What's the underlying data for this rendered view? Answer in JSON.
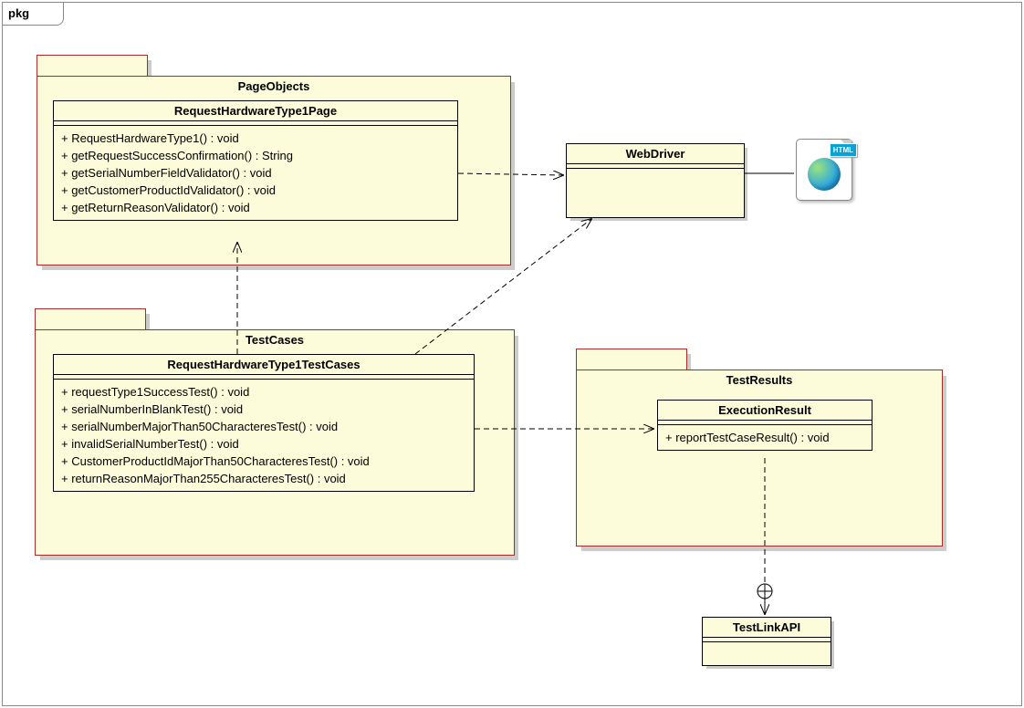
{
  "frame": {
    "label": "pkg"
  },
  "packages": {
    "pageObjects": {
      "title": "PageObjects"
    },
    "testCases": {
      "title": "TestCases"
    },
    "testResults": {
      "title": "TestResults"
    }
  },
  "classes": {
    "requestPage": {
      "name": "RequestHardwareType1Page",
      "ops": [
        "+ RequestHardwareType1() : void",
        "+ getRequestSuccessConfirmation() : String",
        "+ getSerialNumberFieldValidator() : void",
        "+ getCustomerProductIdValidator() : void",
        "+ getReturnReasonValidator() : void"
      ]
    },
    "testCasesCls": {
      "name": "RequestHardwareType1TestCases",
      "ops": [
        "+ requestType1SuccessTest() : void",
        "+ serialNumberInBlankTest() : void",
        "+ serialNumberMajorThan50CharacteresTest() : void",
        "+ invalidSerialNumberTest() : void",
        "+ CustomerProductIdMajorThan50CharacteresTest() : void",
        "+ returnReasonMajorThan255CharacteresTest() : void"
      ]
    },
    "executionResult": {
      "name": "ExecutionResult",
      "ops": [
        "+ reportTestCaseResult() : void"
      ]
    },
    "webDriver": {
      "name": "WebDriver"
    },
    "testLinkAPI": {
      "name": "TestLinkAPI"
    }
  },
  "icons": {
    "html": {
      "badge": "HTML"
    }
  }
}
